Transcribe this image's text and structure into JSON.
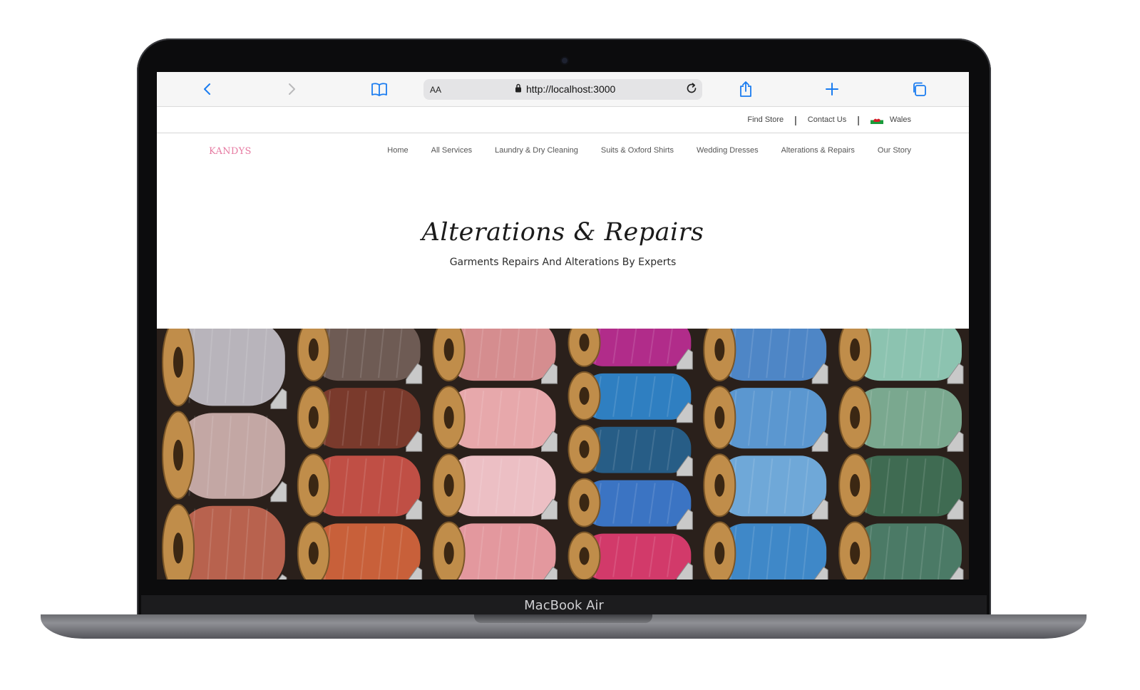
{
  "device": {
    "label": "MacBook Air"
  },
  "browser": {
    "text_size_label": "AA",
    "url": "http://localhost:3000",
    "icons": [
      "back-icon",
      "forward-icon",
      "bookmarks-icon",
      "lock-icon",
      "reload-icon",
      "share-icon",
      "new-tab-icon",
      "tabs-icon"
    ]
  },
  "utility": {
    "find_store": "Find Store",
    "divider": "|",
    "contact_us": "Contact Us",
    "region": "Wales"
  },
  "nav": {
    "logo": "KANDYS",
    "items": [
      "Home",
      "All Services",
      "Laundry & Dry Cleaning",
      "Suits & Oxford Shirts",
      "Wedding Dresses",
      "Alterations & Repairs",
      "Our Story"
    ]
  },
  "hero": {
    "title": "Alterations & Repairs",
    "subtitle": "Garments Repairs And Alterations By Experts"
  },
  "colors": {
    "accent": "#e67aa1",
    "ios_blue": "#1a7cf0"
  },
  "photo": {
    "columns": [
      [
        "#b8b4bb",
        "#c3a7a4",
        "#b8624e"
      ],
      [
        "#6e5b54",
        "#7a3a2c",
        "#c04f45",
        "#c8603a"
      ],
      [
        "#d58d8f",
        "#e7a8ab",
        "#ecbfc4",
        "#e3989e"
      ],
      [
        "#b12c8a",
        "#2f7fc1",
        "#275d86",
        "#3b74c3",
        "#d23a6a"
      ],
      [
        "#4e86c6",
        "#5b97d0",
        "#6fa8d8",
        "#3f88c8"
      ],
      [
        "#8cc3b0",
        "#7aa88f",
        "#3f6b52",
        "#4b7a66"
      ]
    ]
  }
}
